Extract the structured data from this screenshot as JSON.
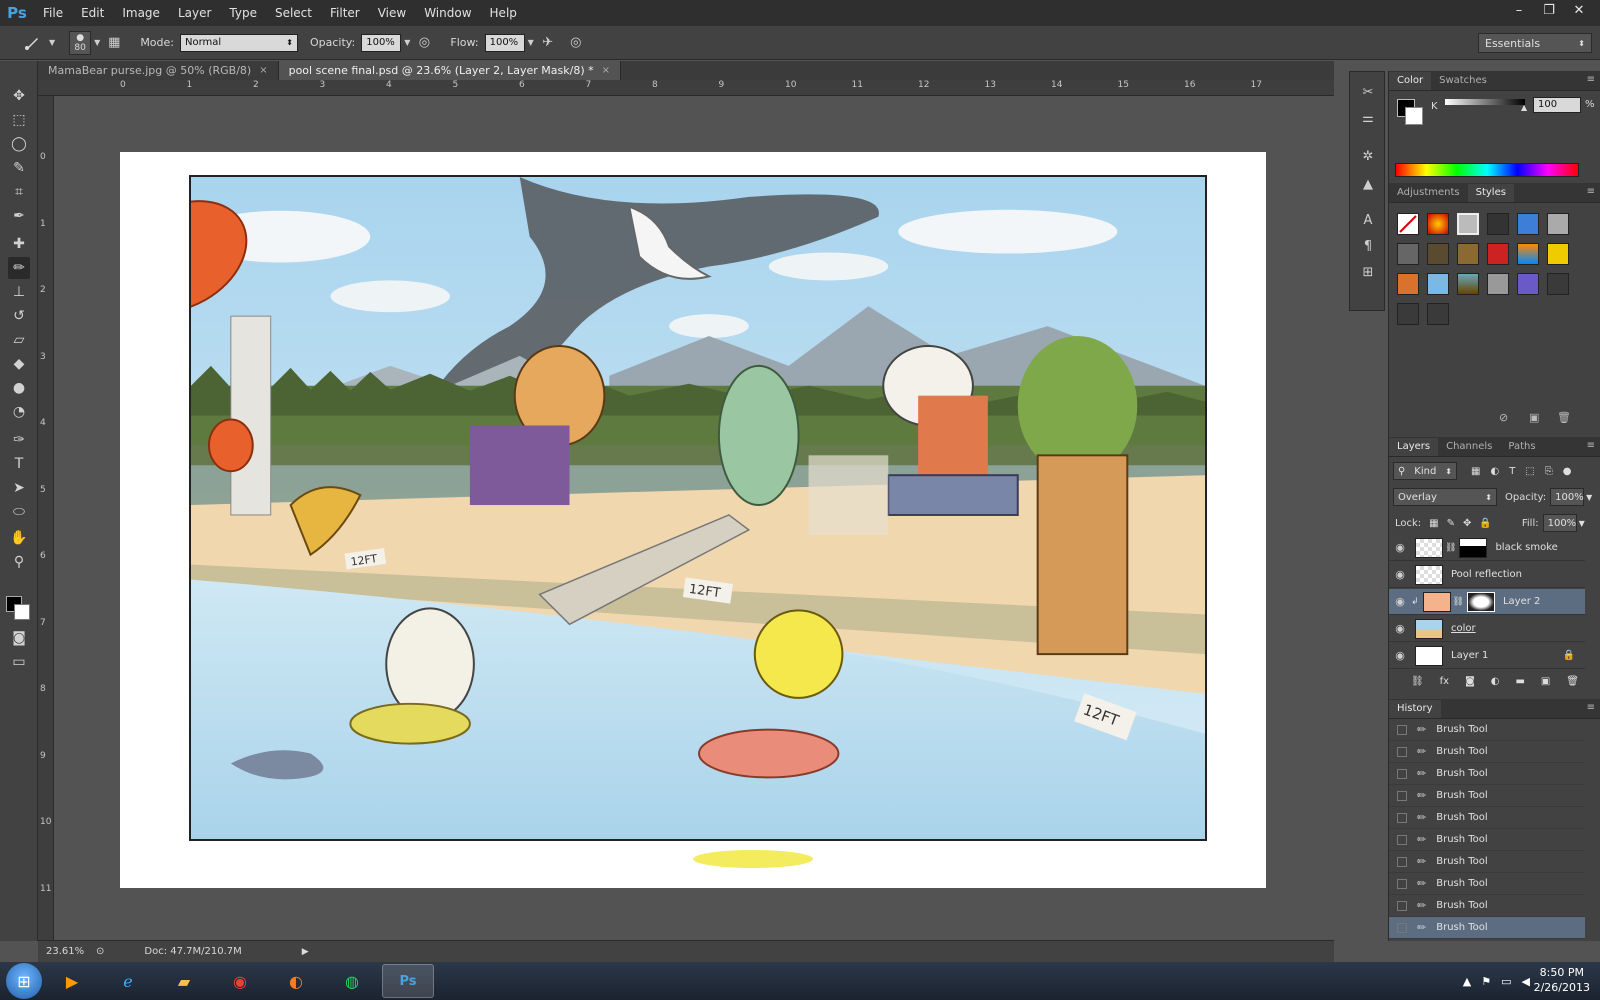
{
  "app": {
    "logo": "Ps"
  },
  "menu": [
    "File",
    "Edit",
    "Image",
    "Layer",
    "Type",
    "Select",
    "Filter",
    "View",
    "Window",
    "Help"
  ],
  "window_controls": {
    "minimize": "–",
    "restore": "❐",
    "close": "✕"
  },
  "options": {
    "brush_size": "80",
    "mode_label": "Mode:",
    "mode_value": "Normal",
    "opacity_label": "Opacity:",
    "opacity_value": "100%",
    "flow_label": "Flow:",
    "flow_value": "100%",
    "workspace": "Essentials"
  },
  "tabs": [
    {
      "label": "MamaBear purse.jpg @ 50% (RGB/8)",
      "close": "×",
      "active": false
    },
    {
      "label": "pool scene final.psd @ 23.6% (Layer 2, Layer Mask/8) *",
      "close": "×",
      "active": true
    }
  ],
  "ruler": {
    "top": [
      "0",
      "1",
      "2",
      "3",
      "4",
      "5",
      "6",
      "7",
      "8",
      "9",
      "10",
      "11",
      "12",
      "13",
      "14",
      "15",
      "16",
      "17"
    ],
    "left": [
      "0",
      "1",
      "2",
      "3",
      "4",
      "5",
      "6",
      "7",
      "8",
      "9",
      "10",
      "11"
    ]
  },
  "status": {
    "zoom": "23.61%",
    "doc": "Doc: 47.7M/210.7M",
    "arrow": "▶"
  },
  "color_panel": {
    "tabs": [
      "Color",
      "Swatches"
    ],
    "channel": "K",
    "value": "100",
    "pct": "%",
    "k_level": 1.0
  },
  "styles_panel": {
    "tabs": [
      "Adjustments",
      "Styles"
    ]
  },
  "layers_panel": {
    "tabs": [
      "Layers",
      "Channels",
      "Paths"
    ],
    "kind": "Kind",
    "blend_mode": "Overlay",
    "opacity_label": "Opacity:",
    "opacity_value": "100%",
    "lock_label": "Lock:",
    "fill_label": "Fill:",
    "fill_value": "100%",
    "layers": [
      {
        "name": "black smoke",
        "selected": false
      },
      {
        "name": "Pool reflection",
        "selected": false
      },
      {
        "name": "Layer 2",
        "selected": true
      },
      {
        "name": "color",
        "selected": false
      },
      {
        "name": "Layer 1",
        "selected": false
      }
    ]
  },
  "history_panel": {
    "title": "History",
    "items": [
      "Brush Tool",
      "Brush Tool",
      "Brush Tool",
      "Brush Tool",
      "Brush Tool",
      "Brush Tool",
      "Brush Tool",
      "Brush Tool",
      "Brush Tool",
      "Brush Tool"
    ]
  },
  "artwork": {
    "depth_marker": "12FT"
  },
  "taskbar": {
    "clock_time": "8:50 PM",
    "clock_date": "2/26/2013"
  },
  "colors": {
    "accent_selected": "#5c6d82",
    "ps_blue": "#4aa3df"
  }
}
